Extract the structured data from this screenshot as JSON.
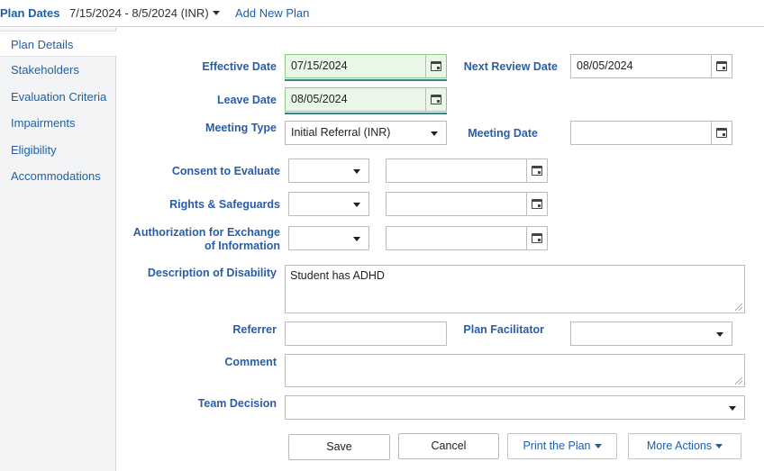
{
  "topbar": {
    "label": "Plan Dates",
    "date_range": "7/15/2024 - 8/5/2024 (INR)",
    "add_plan": "Add New Plan"
  },
  "sidebar": {
    "items": [
      {
        "label": "Plan Details"
      },
      {
        "label": "Stakeholders"
      },
      {
        "label": "Evaluation Criteria"
      },
      {
        "label": "Impairments"
      },
      {
        "label": "Eligibility"
      },
      {
        "label": "Accommodations"
      }
    ]
  },
  "form": {
    "effective_date": {
      "label": "Effective Date",
      "value": "07/15/2024"
    },
    "next_review_date": {
      "label": "Next Review Date",
      "value": "08/05/2024"
    },
    "leave_date": {
      "label": "Leave Date",
      "value": "08/05/2024"
    },
    "meeting_type": {
      "label": "Meeting Type",
      "value": "Initial Referral (INR)"
    },
    "meeting_date": {
      "label": "Meeting Date",
      "value": ""
    },
    "consent_to_evaluate": {
      "label": "Consent to Evaluate",
      "value": "",
      "date": ""
    },
    "rights_safeguards": {
      "label": "Rights & Safeguards",
      "value": "",
      "date": ""
    },
    "authorization": {
      "label_line1": "Authorization for Exchange",
      "label_line2": "of Information",
      "value": "",
      "date": ""
    },
    "description": {
      "label": "Description of Disability",
      "value": "Student has ADHD"
    },
    "referrer": {
      "label": "Referrer",
      "value": ""
    },
    "plan_facilitator": {
      "label": "Plan Facilitator",
      "value": ""
    },
    "comment": {
      "label": "Comment",
      "value": ""
    },
    "team_decision": {
      "label": "Team Decision",
      "value": ""
    }
  },
  "actions": {
    "save": "Save",
    "cancel": "Cancel",
    "print": "Print the Plan",
    "more": "More Actions"
  },
  "colors": {
    "label_blue": "#2a5da8",
    "highlight_green": "#e9f7e6",
    "underline_teal": "#2e8a86"
  }
}
